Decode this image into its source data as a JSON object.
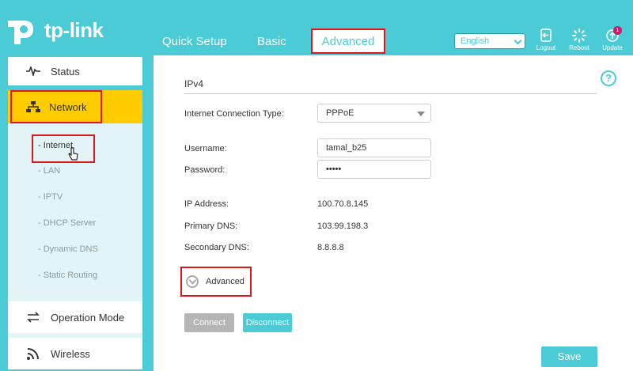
{
  "brand": {
    "logo_text": "tp-link"
  },
  "nav": {
    "tabs": [
      "Quick Setup",
      "Basic",
      "Advanced"
    ],
    "active_tab": "Advanced"
  },
  "language": {
    "selected": "English"
  },
  "tools": {
    "logout": "Logout",
    "reboot": "Reboot",
    "update": "Update",
    "update_badge": "1"
  },
  "sidebar": {
    "status": "Status",
    "network": "Network",
    "sub_items": [
      "Internet",
      "LAN",
      "IPTV",
      "DHCP Server",
      "Dynamic DNS",
      "Static Routing"
    ],
    "operation_mode": "Operation Mode",
    "wireless": "Wireless"
  },
  "main": {
    "section_title": "IPv4",
    "help_icon": "?",
    "connection_type_label": "Internet Connection Type:",
    "connection_type_value": "PPPoE",
    "username_label": "Username:",
    "username_value": "tamal_b25",
    "password_label": "Password:",
    "password_value": "•••••",
    "ip_label": "IP Address:",
    "ip_value": "100.70.8.145",
    "primary_dns_label": "Primary DNS:",
    "primary_dns_value": "103.99.198.3",
    "secondary_dns_label": "Secondary DNS:",
    "secondary_dns_value": "8.8.8.8",
    "advanced_toggle": "Advanced",
    "connect_button": "Connect",
    "disconnect_button": "Disconnect",
    "save_button": "Save"
  },
  "colors": {
    "accent": "#4acbd6",
    "active_nav": "#ffcc00",
    "highlight": "#e0161b",
    "badge": "#d6156b"
  }
}
